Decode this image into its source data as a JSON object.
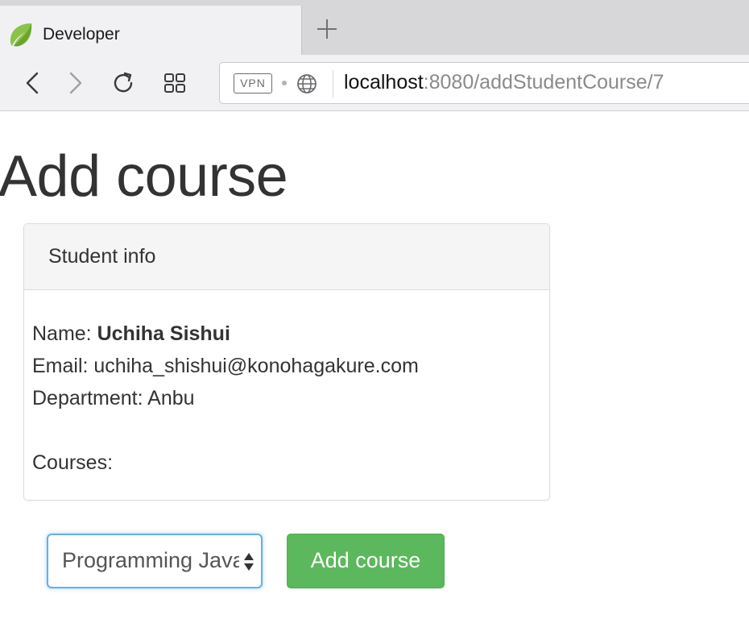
{
  "browser": {
    "tab": {
      "title": "Developer",
      "favicon": "leaf-icon"
    },
    "new_tab_icon": "plus-icon",
    "toolbar": {
      "back_icon": "chevron-left-icon",
      "forward_icon": "chevron-right-icon",
      "reload_icon": "reload-icon",
      "grid_icon": "grid-icon"
    },
    "address_bar": {
      "vpn_badge": "VPN",
      "globe_icon": "globe-icon",
      "url_host": "localhost",
      "url_rest": ":8080/addStudentCourse/7"
    }
  },
  "page": {
    "title": "Add course",
    "student_panel": {
      "heading": "Student info",
      "name_label": "Name: ",
      "name_value": "Uchiha Sishui",
      "email_label": "Email: ",
      "email_value": "uchiha_shishui@konohagakure.com",
      "department_label": "Department: ",
      "department_value": "Anbu",
      "courses_label": "Courses:"
    },
    "course_select": {
      "selected": "Programming Java",
      "arrows_icon": "select-arrows-icon"
    },
    "add_button_label": "Add course"
  },
  "colors": {
    "button_success": "#5cb85c",
    "select_focus": "#66afe9",
    "panel_heading_bg": "#f5f5f5",
    "text": "#333333"
  }
}
